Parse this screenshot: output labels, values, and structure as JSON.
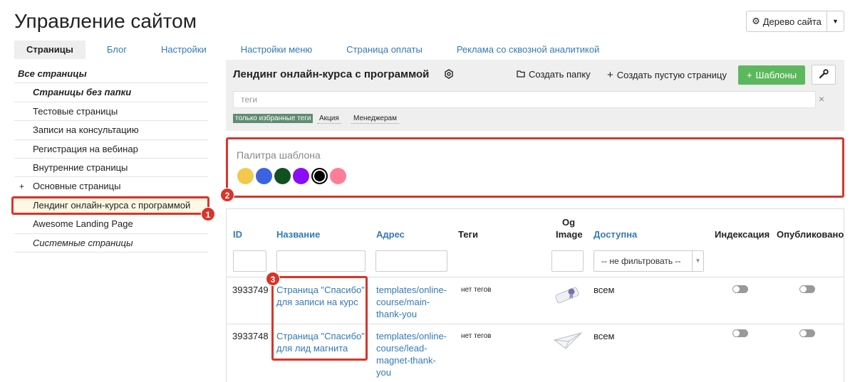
{
  "header": {
    "title": "Управление сайтом",
    "tree_button": "Дерево сайта"
  },
  "tabs": [
    "Страницы",
    "Блог",
    "Настройки",
    "Настройки меню",
    "Страница оплаты",
    "Реклама со сквозной аналитикой"
  ],
  "sidebar": {
    "items": [
      {
        "label": "Все страницы"
      },
      {
        "label": "Страницы без папки"
      },
      {
        "label": "Тестовые страницы"
      },
      {
        "label": "Записи на консультацию"
      },
      {
        "label": "Регистрация на вебинар"
      },
      {
        "label": "Внутренние страницы"
      },
      {
        "label": "Основные страницы",
        "expand": "+"
      },
      {
        "label": "Лендинг онлайн-курса с программой"
      },
      {
        "label": "Awesome Landing Page"
      },
      {
        "label": "Системные страницы"
      }
    ]
  },
  "main": {
    "page_name": "Лендинг онлайн-курса с программой",
    "create_folder": "Создать папку",
    "create_page": "Создать пустую страницу",
    "templates_button": "Шаблоны",
    "tags_placeholder": "теги",
    "tag_filters": [
      "только избранные теги",
      "Акция",
      "Менеджерам"
    ]
  },
  "palette": {
    "label": "Палитра шаблона",
    "colors": [
      "#f2c94c",
      "#3b63e0",
      "#12501f",
      "#8b0cf8",
      "#000000",
      "#ff7d96"
    ],
    "selected_index": 4
  },
  "table": {
    "headers": {
      "id": "ID",
      "name": "Название",
      "address": "Адрес",
      "tags": "Теги",
      "og1": "Og",
      "og2": "Image",
      "available": "Доступна",
      "indexing": "Индексация",
      "published": "Опубликовано"
    },
    "filter_select": "-- не фильтровать --",
    "rows": [
      {
        "id": "3933749",
        "name1": "Страница \"Спасибо\"",
        "name2": "для записи на курс",
        "addr1": "templates/online-",
        "addr2": "course/main-",
        "addr3": "thank-you",
        "addr4": "",
        "tags": "нет тегов",
        "available": "всем",
        "og_icon": "diploma-icon"
      },
      {
        "id": "3933748",
        "name1": "Страница \"Спасибо\"",
        "name2": "для лид магнита",
        "addr1": "templates/online-",
        "addr2": "course/lead-",
        "addr3": "magnet-thank-",
        "addr4": "you",
        "tags": "нет тегов",
        "available": "всем",
        "og_icon": "paper-plane-icon"
      }
    ]
  },
  "annotations": [
    "1",
    "2",
    "3"
  ]
}
